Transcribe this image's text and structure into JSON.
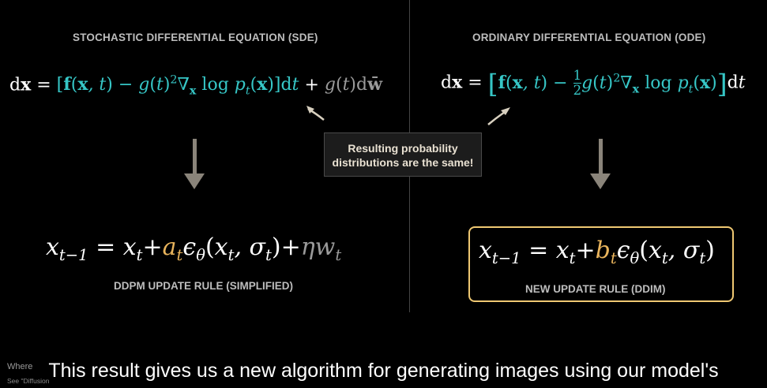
{
  "left_panel": {
    "title": "STOCHASTIC DIFFERENTIAL EQUATION (SDE)",
    "rule_label": "DDPM UPDATE RULE (SIMPLIFIED)"
  },
  "right_panel": {
    "title": "ORDINARY DIFFERENTIAL EQUATION (ODE)",
    "rule_label": "NEW UPDATE RULE (DDIM)"
  },
  "callout": {
    "line1": "Resulting probability",
    "line2": "distributions are the same!"
  },
  "footnote": {
    "line1": "Where",
    "line2": "See \"Diffusion"
  },
  "caption": "This result gives us a new algorithm for generating images using our model's",
  "colors": {
    "teal": "#36c6c6",
    "gold": "#e9b45c",
    "box_border": "#efc872",
    "arrow": "#8a847a"
  }
}
